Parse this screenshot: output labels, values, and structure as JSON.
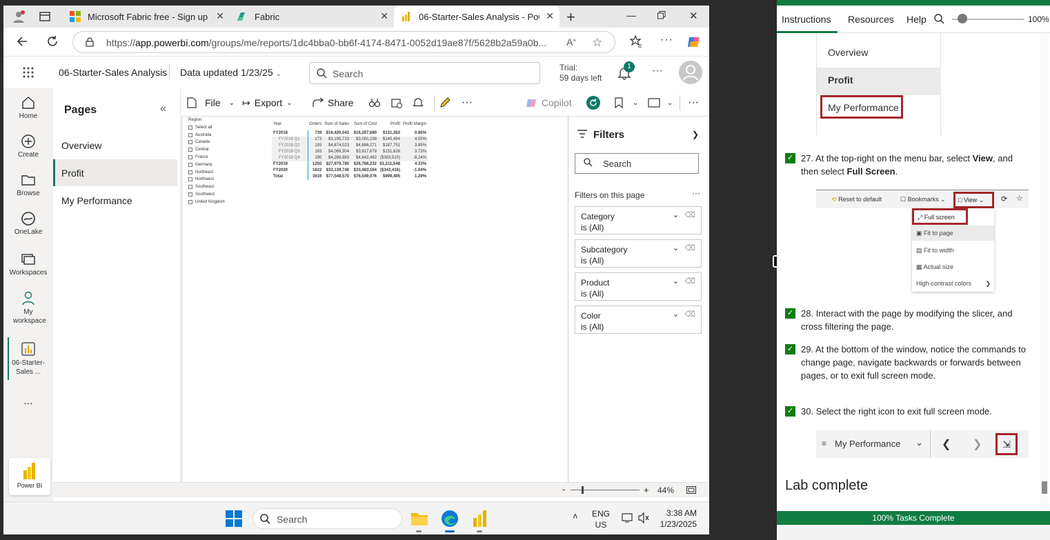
{
  "browser": {
    "tabs": [
      {
        "title": "Microsoft Fabric free - Sign up",
        "icon": "microsoft-logo-icon"
      },
      {
        "title": "Fabric",
        "icon": "fabric-logo-icon"
      },
      {
        "title": "06-Starter-Sales Analysis - Powe",
        "icon": "powerbi-logo-icon",
        "active": true
      }
    ],
    "new_tab": "+",
    "url_prefix": "https://",
    "url_host": "app.powerbi.com",
    "url_path": "/groups/me/reports/1dc4bba0-bb6f-4174-8471-0052d19ae87f/5628b2a59a0b..."
  },
  "powerbi": {
    "report_name": "06-Starter-Sales Analysis",
    "data_updated": "Data updated 1/23/25",
    "search_placeholder": "Search",
    "trial_line1": "Trial:",
    "trial_line2": "59 days left",
    "notification_count": "1",
    "nav": [
      {
        "label": "Home",
        "icon": "home-icon"
      },
      {
        "label": "Create",
        "icon": "create-icon"
      },
      {
        "label": "Browse",
        "icon": "folder-icon"
      },
      {
        "label": "OneLake",
        "icon": "onelake-icon"
      },
      {
        "label": "Workspaces",
        "icon": "workspaces-icon"
      },
      {
        "label": "My workspace",
        "icon": "my-workspace-icon"
      },
      {
        "label": "06-Starter-Sales ...",
        "icon": "report-icon"
      }
    ],
    "nav_more": "...",
    "brand": "Power BI",
    "pages_title": "Pages",
    "pages": [
      "Overview",
      "Profit",
      "My Performance"
    ],
    "toolbar": {
      "file": "File",
      "export": "Export",
      "share": "Share",
      "copilot": "Copilot"
    },
    "filters": {
      "title": "Filters",
      "search": "Search",
      "on_this_page": "Filters on this page",
      "cards": [
        {
          "field": "Category",
          "value": "is (All)"
        },
        {
          "field": "Subcategory",
          "value": "is (All)"
        },
        {
          "field": "Product",
          "value": "is (All)"
        },
        {
          "field": "Color",
          "value": "is (All)"
        }
      ]
    },
    "slicer": {
      "title": "Region",
      "items": [
        "Select all",
        "Australia",
        "Canada",
        "Central",
        "France",
        "Germany",
        "Northeast",
        "Northwest",
        "Southeast",
        "Southwest",
        "United Kingdom"
      ]
    },
    "matrix": {
      "headers": [
        "Year",
        "Orders",
        "Sum of Sales",
        "Sum of Cost",
        "Profit",
        "Profit Margin"
      ],
      "rows": [
        [
          "FY2018",
          "739",
          "$16,429,043",
          "$16,297,680",
          "$131,362",
          "0.80%"
        ],
        [
          "FY2018 Q1",
          "173",
          "$3,195,733",
          "$3,050,238",
          "$145,494",
          "4.55%"
        ],
        [
          "FY2018 Q2",
          "193",
          "$4,874,023",
          "$4,686,271",
          "$187,751",
          "3.85%"
        ],
        [
          "FY2018 Q3",
          "183",
          "$4,069,304",
          "$3,917,678",
          "$151,626",
          "3.73%"
        ],
        [
          "FY2018 Q4",
          "190",
          "$4,289,983",
          "$4,643,492",
          "($353,510)",
          "-8.24%"
        ],
        [
          "FY2019",
          "1255",
          "$27,979,780",
          "$26,768,232",
          "$1,211,548",
          "4.33%"
        ],
        [
          "FY2020",
          "1622",
          "$33,139,748",
          "$33,483,164",
          "($343,416)",
          "-1.04%"
        ],
        [
          "Total",
          "3616",
          "$77,548,570",
          "$76,549,076",
          "$999,495",
          "1.29%"
        ]
      ]
    },
    "zoom": "44%"
  },
  "taskbar": {
    "search": "Search",
    "lang1": "ENG",
    "lang2": "US",
    "time": "3:38 AM",
    "date": "1/23/2025"
  },
  "lab": {
    "tabs": [
      "Instructions",
      "Resources",
      "Help"
    ],
    "zoom": "100%",
    "menu": [
      "Overview",
      "Profit",
      "My Performance"
    ],
    "steps": [
      {
        "num": "27.",
        "pre": "At the top-right on the menu bar, select ",
        "b1": "View",
        "mid": ", and then select ",
        "b2": "Full Screen",
        "post": "."
      },
      {
        "num": "28.",
        "text": "Interact with the page by modifying the slicer, and cross filtering the page."
      },
      {
        "num": "29.",
        "text": "At the bottom of the window, notice the commands to change page, navigate backwards or forwards between pages, or to exit full screen mode."
      },
      {
        "num": "30.",
        "text": "Select the right icon to exit full screen mode."
      }
    ],
    "view_shot": {
      "reset": "Reset to default",
      "bookmarks": "Bookmarks",
      "view": "View",
      "items": [
        "Full screen",
        "Fit to page",
        "Fit to width",
        "Actual size",
        "High-contrast colors"
      ]
    },
    "nav_shot": {
      "page": "My Performance"
    },
    "complete_heading": "Lab complete",
    "progress": "100% Tasks Complete"
  }
}
